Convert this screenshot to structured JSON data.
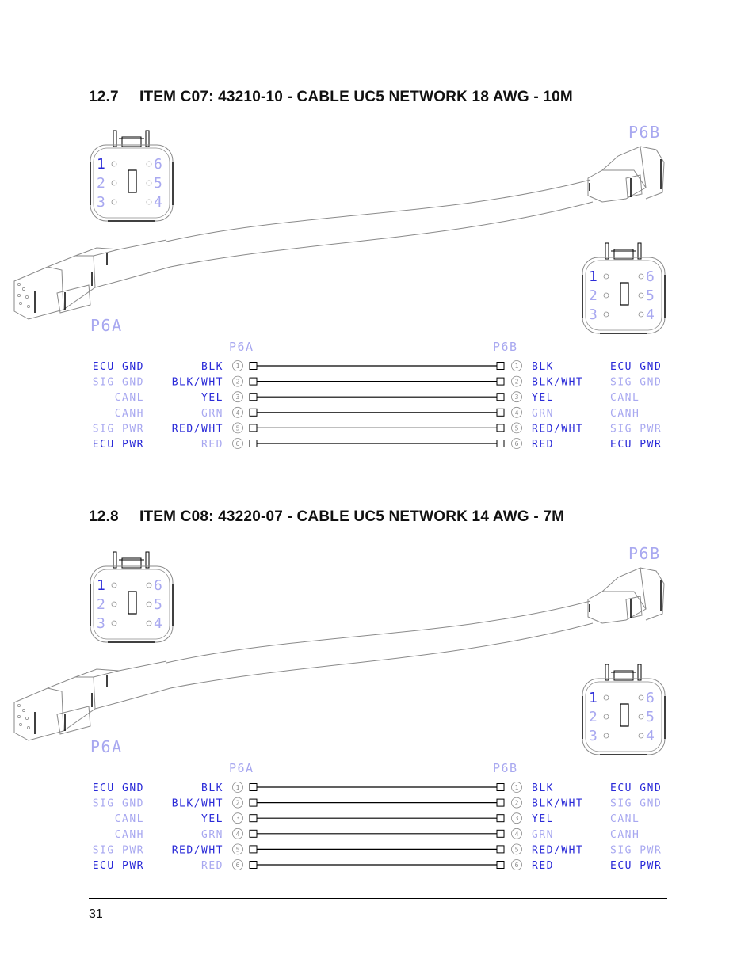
{
  "page": {
    "number": "31"
  },
  "colors": {
    "cad_blue": "#2a2ad8",
    "cad_light_blue": "#a8a8f0",
    "line": "#000000",
    "outline_gray": "#8a8a8a"
  },
  "sections": [
    {
      "number": "12.7",
      "title": "ITEM C07: 43210-10 - CABLE UC5 NETWORK 18 AWG - 10M",
      "connector_a": {
        "label": "P6A",
        "pins_left": [
          "1",
          "2",
          "3"
        ],
        "pins_right": [
          "6",
          "5",
          "4"
        ]
      },
      "connector_b": {
        "label": "P6B",
        "pins_left": [
          "1",
          "2",
          "3"
        ],
        "pins_right": [
          "6",
          "5",
          "4"
        ]
      },
      "wiring": {
        "header_a": "P6A",
        "header_b": "P6B",
        "rows": [
          {
            "pin": "1",
            "signal_a": "ECU GND",
            "color_a": "BLK",
            "color_b": "BLK",
            "signal_b": "ECU GND"
          },
          {
            "pin": "2",
            "signal_a": "SIG GND",
            "color_a": "BLK/WHT",
            "color_b": "BLK/WHT",
            "signal_b": "SIG GND"
          },
          {
            "pin": "3",
            "signal_a": "CANL",
            "color_a": "YEL",
            "color_b": "YEL",
            "signal_b": "CANL"
          },
          {
            "pin": "4",
            "signal_a": "CANH",
            "color_a": "GRN",
            "color_b": "GRN",
            "signal_b": "CANH"
          },
          {
            "pin": "5",
            "signal_a": "SIG PWR",
            "color_a": "RED/WHT",
            "color_b": "RED/WHT",
            "signal_b": "SIG PWR"
          },
          {
            "pin": "6",
            "signal_a": "ECU PWR",
            "color_a": "RED",
            "color_b": "RED",
            "signal_b": "ECU PWR"
          }
        ]
      }
    },
    {
      "number": "12.8",
      "title": "ITEM C08: 43220-07 - CABLE UC5 NETWORK 14 AWG - 7M",
      "connector_a": {
        "label": "P6A",
        "pins_left": [
          "1",
          "2",
          "3"
        ],
        "pins_right": [
          "6",
          "5",
          "4"
        ]
      },
      "connector_b": {
        "label": "P6B",
        "pins_left": [
          "1",
          "2",
          "3"
        ],
        "pins_right": [
          "6",
          "5",
          "4"
        ]
      },
      "wiring": {
        "header_a": "P6A",
        "header_b": "P6B",
        "rows": [
          {
            "pin": "1",
            "signal_a": "ECU GND",
            "color_a": "BLK",
            "color_b": "BLK",
            "signal_b": "ECU GND"
          },
          {
            "pin": "2",
            "signal_a": "SIG GND",
            "color_a": "BLK/WHT",
            "color_b": "BLK/WHT",
            "signal_b": "SIG GND"
          },
          {
            "pin": "3",
            "signal_a": "CANL",
            "color_a": "YEL",
            "color_b": "YEL",
            "signal_b": "CANL"
          },
          {
            "pin": "4",
            "signal_a": "CANH",
            "color_a": "GRN",
            "color_b": "GRN",
            "signal_b": "CANH"
          },
          {
            "pin": "5",
            "signal_a": "SIG PWR",
            "color_a": "RED/WHT",
            "color_b": "RED/WHT",
            "signal_b": "SIG PWR"
          },
          {
            "pin": "6",
            "signal_a": "ECU PWR",
            "color_a": "RED",
            "color_b": "RED",
            "signal_b": "ECU PWR"
          }
        ]
      }
    }
  ]
}
